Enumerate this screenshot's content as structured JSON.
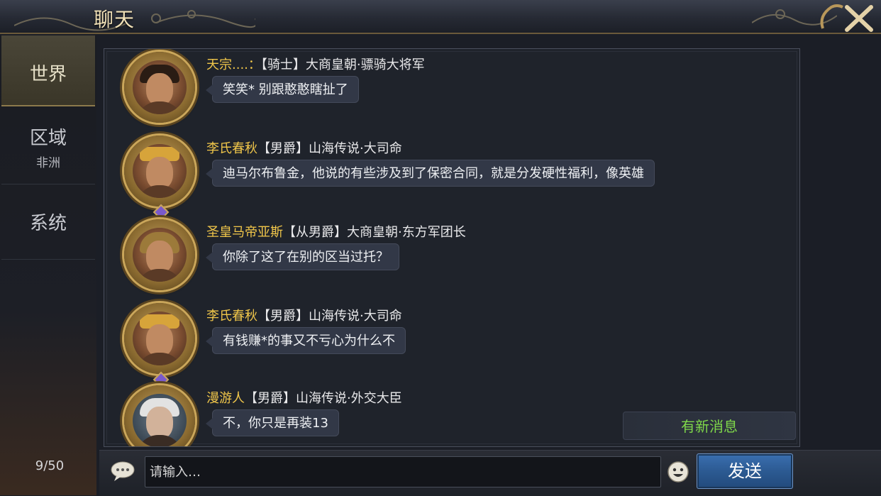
{
  "header": {
    "title": "聊天",
    "close_label": "X"
  },
  "sidebar": {
    "tabs": [
      {
        "label": "世界",
        "sub": ""
      },
      {
        "label": "区域",
        "sub": "非洲"
      },
      {
        "label": "系统",
        "sub": ""
      }
    ],
    "active_tab": "世界",
    "counter": "9/50"
  },
  "messages": [
    {
      "sender": "天宗....：",
      "title": "【骑士】大商皇朝·骠骑大将军",
      "text": "笑笑* 别跟憨憨瞎扯了",
      "avatar": "warrior-portrait"
    },
    {
      "sender": "李氏春秋",
      "title": "【男爵】山海传说·大司命",
      "text": "迪马尔布鲁金，他说的有些涉及到了保密合同，就是分发硬性福利，像英雄",
      "avatar": "king-portrait"
    },
    {
      "sender": "圣皇马帝亚斯",
      "title": "【从男爵】大商皇朝·东方军团长",
      "text": "你除了这了在别的区当过托？",
      "avatar": "helmet-portrait"
    },
    {
      "sender": "李氏春秋",
      "title": "【男爵】山海传说·大司命",
      "text": "有钱赚*的事又不亏心为什么不",
      "avatar": "king-portrait"
    },
    {
      "sender": "漫游人",
      "title": "【男爵】山海传说·外交大臣",
      "text": "不，你只是再装13",
      "avatar": "elder-portrait"
    }
  ],
  "new_message_tag": "有新消息",
  "input": {
    "placeholder": "请输入…",
    "value": ""
  },
  "send_button": "发送",
  "colors": {
    "sender_name": "#f0c64a",
    "new_message": "#7fd84a",
    "send_button": "#2c5a92",
    "header_title": "#f2e2b8"
  }
}
